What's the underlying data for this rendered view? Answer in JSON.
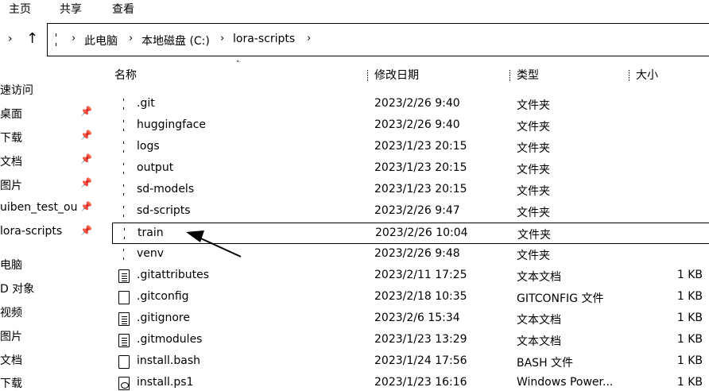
{
  "ribbon": {
    "tabs": [
      "主页",
      "共享",
      "查看"
    ]
  },
  "address": {
    "back_icon": "chevron-right-icon",
    "up_icon": "arrow-up-icon",
    "crumbs": [
      "此电脑",
      "本地磁盘 (C:)",
      "lora-scripts"
    ],
    "separator": "›"
  },
  "columns": {
    "name": "名称",
    "date": "修改日期",
    "type": "类型",
    "size": "大小"
  },
  "sidebar": {
    "items": [
      {
        "label": "速访问",
        "pinned": false
      },
      {
        "label": "桌面",
        "pinned": true
      },
      {
        "label": "下载",
        "pinned": true
      },
      {
        "label": "文档",
        "pinned": true
      },
      {
        "label": "图片",
        "pinned": true
      },
      {
        "label": "uiben_test_ou",
        "pinned": true
      },
      {
        "label": "lora-scripts",
        "pinned": true
      },
      {
        "label": "电脑",
        "pinned": false
      },
      {
        "label": "D 对象",
        "pinned": false
      },
      {
        "label": "视频",
        "pinned": false
      },
      {
        "label": "图片",
        "pinned": false
      },
      {
        "label": "文档",
        "pinned": false
      },
      {
        "label": "下载",
        "pinned": false
      }
    ],
    "pin_glyph": "📌"
  },
  "files": [
    {
      "name": ".git",
      "date": "2023/2/26 9:40",
      "type": "文件夹",
      "size": "",
      "icon": "folder"
    },
    {
      "name": "huggingface",
      "date": "2023/2/26 9:40",
      "type": "文件夹",
      "size": "",
      "icon": "folder"
    },
    {
      "name": "logs",
      "date": "2023/1/23 20:15",
      "type": "文件夹",
      "size": "",
      "icon": "folder"
    },
    {
      "name": "output",
      "date": "2023/1/23 20:15",
      "type": "文件夹",
      "size": "",
      "icon": "folder"
    },
    {
      "name": "sd-models",
      "date": "2023/1/23 20:15",
      "type": "文件夹",
      "size": "",
      "icon": "folder"
    },
    {
      "name": "sd-scripts",
      "date": "2023/2/26 9:47",
      "type": "文件夹",
      "size": "",
      "icon": "folder"
    },
    {
      "name": "train",
      "date": "2023/2/26 10:04",
      "type": "文件夹",
      "size": "",
      "icon": "folder"
    },
    {
      "name": "venv",
      "date": "2023/2/26 9:48",
      "type": "文件夹",
      "size": "",
      "icon": "folder"
    },
    {
      "name": ".gitattributes",
      "date": "2023/2/11 17:25",
      "type": "文本文档",
      "size": "1 KB",
      "icon": "doc"
    },
    {
      "name": ".gitconfig",
      "date": "2023/2/18 10:35",
      "type": "GITCONFIG 文件",
      "size": "1 KB",
      "icon": "blank"
    },
    {
      "name": ".gitignore",
      "date": "2023/2/6 15:34",
      "type": "文本文档",
      "size": "1 KB",
      "icon": "doc"
    },
    {
      "name": ".gitmodules",
      "date": "2023/1/23 13:29",
      "type": "文本文档",
      "size": "1 KB",
      "icon": "doc"
    },
    {
      "name": "install.bash",
      "date": "2023/1/24 17:56",
      "type": "BASH 文件",
      "size": "1 KB",
      "icon": "blank"
    },
    {
      "name": "install.ps1",
      "date": "2023/1/23 16:16",
      "type": "Windows Power...",
      "size": "1 KB",
      "icon": "script"
    }
  ],
  "selected_file": "train"
}
